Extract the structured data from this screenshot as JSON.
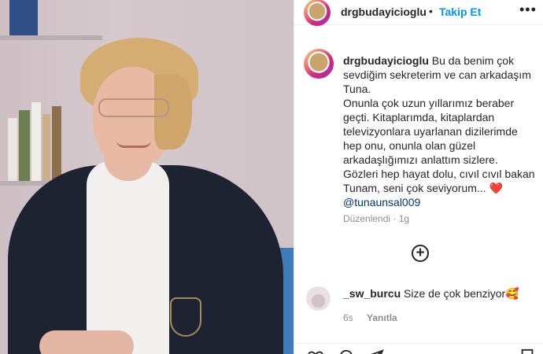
{
  "header": {
    "username": "drgbudayicioglu",
    "separator": "•",
    "follow_label": "Takip Et",
    "more_label": "•••"
  },
  "caption": {
    "username": "drgbudayicioglu",
    "lines": [
      "Bu da benim çok",
      "sevdiğim sekreterim ve can arkadaşım",
      "Tuna.",
      "Onunla çok uzun yıllarımız beraber",
      "geçti. Kitaplarımda, kitaplardan",
      "televizyonlara uyarlanan dizilerimde",
      "hep onu, onunla olan güzel",
      "arkadaşlığımızı anlattım sizlere.",
      "Gözleri hep hayat dolu, cıvıl cıvıl bakan",
      "Tunam, seni çok seviyorum..."
    ],
    "heart": "❤️",
    "mention": "@tunaunsal009",
    "edited": "Düzenlendi",
    "time": "1g"
  },
  "load_more": {
    "icon": "plus-circle-icon",
    "label": "+"
  },
  "comment": {
    "username": "_sw_burcu",
    "text": "Size de çok benziyor🥰",
    "time": "6s",
    "reply_label": "Yanıtla"
  },
  "icons": {
    "like": "heart-outline-icon",
    "comment": "comment-icon",
    "share": "send-icon",
    "save": "bookmark-icon"
  },
  "colors": {
    "follow": "#0095f6",
    "mention": "#00376b",
    "muted": "#8e8e8e",
    "text": "#262626"
  }
}
